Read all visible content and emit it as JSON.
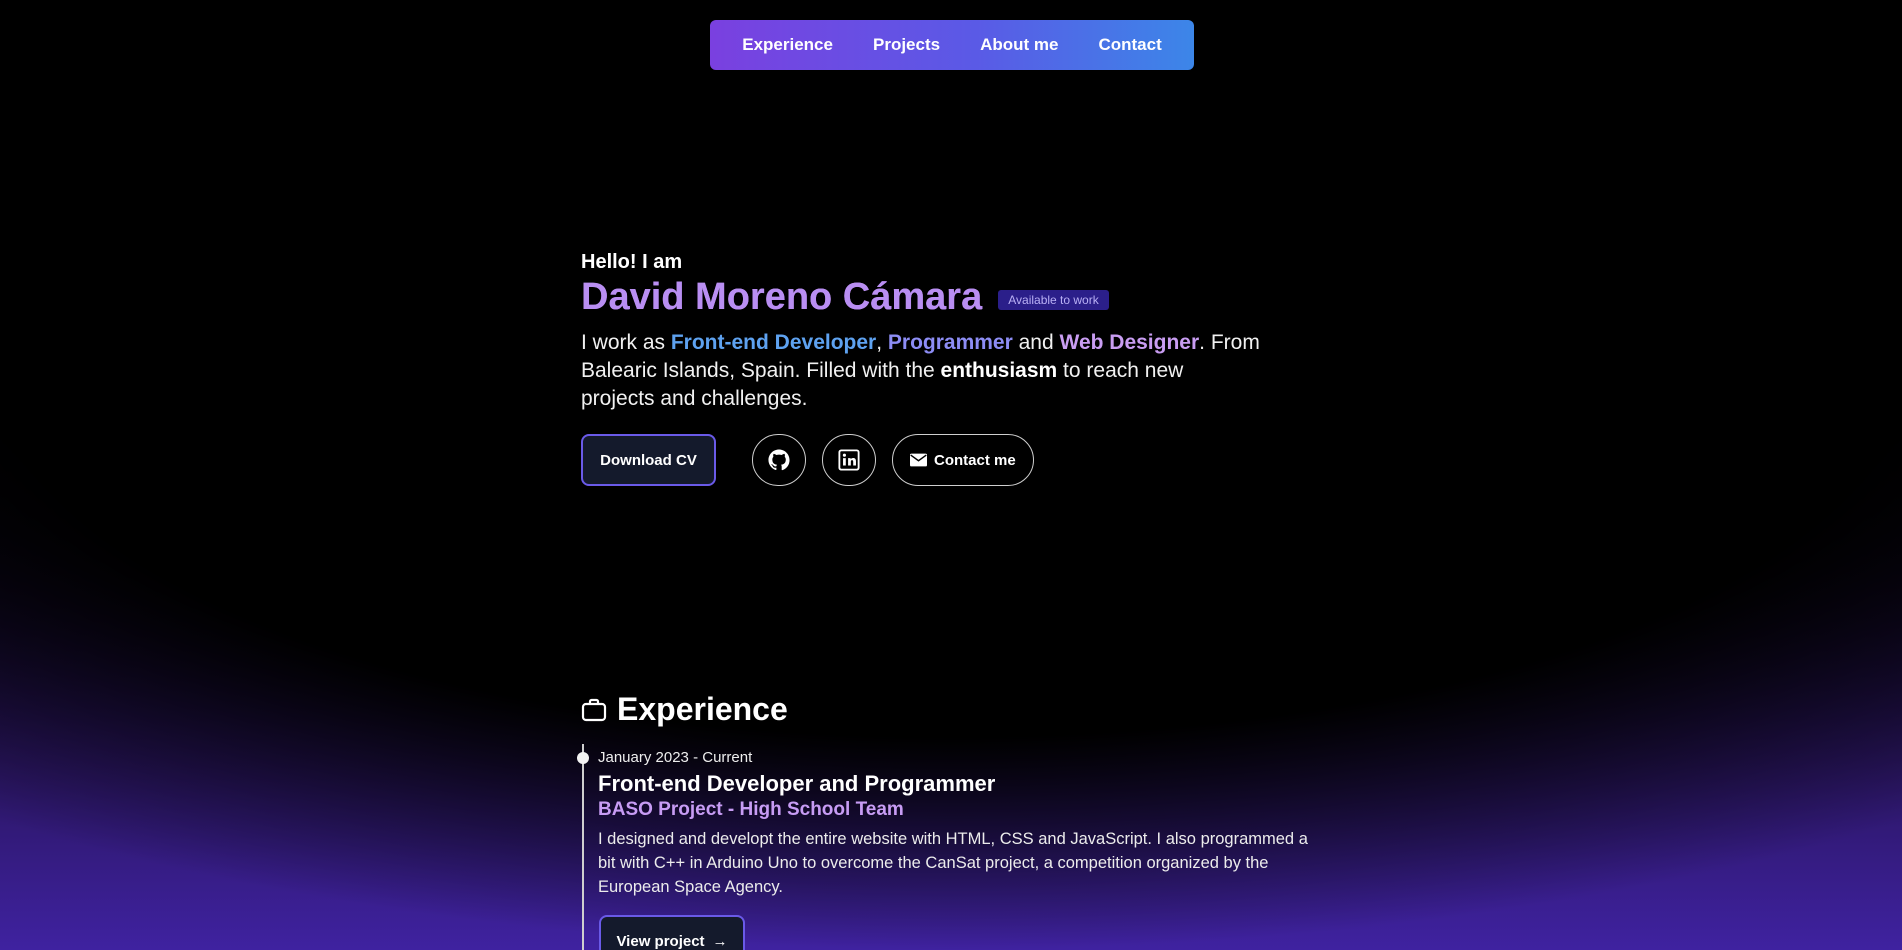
{
  "nav": {
    "items": [
      {
        "label": "Experience"
      },
      {
        "label": "Projects"
      },
      {
        "label": "About me"
      },
      {
        "label": "Contact"
      }
    ]
  },
  "hero": {
    "greeting": "Hello! I am",
    "name": "David Moreno Cámara",
    "badge": "Available to work",
    "intro": {
      "p1": "I work as ",
      "role1": "Front-end Developer",
      "p2": ", ",
      "role2": "Programmer",
      "p3": " and ",
      "role3": "Web Designer",
      "p4": ". From Balearic Islands, Spain. Filled with the ",
      "highlight": "enthusiasm",
      "p5": " to reach new projects and challenges."
    },
    "download_cv_label": "Download CV",
    "contact_label": "Contact me",
    "icons": [
      "github-icon",
      "linkedin-icon",
      "mail-icon"
    ]
  },
  "experience": {
    "title": "Experience",
    "icon": "briefcase-icon",
    "items": [
      {
        "date": "January 2023 - Current",
        "role": "Front-end Developer and Programmer",
        "company": "BASO Project - High School Team",
        "description": "I designed and developt the entire website with HTML, CSS and JavaScript. I also programmed a bit with C++ in Arduino Uno to overcome the CanSat project, a competition organized by the European Space Agency.",
        "button_label": "View project",
        "button_arrow": "→"
      }
    ]
  },
  "colors": {
    "accent_purple": "#b98ef2",
    "accent_blue": "#5ea2f0",
    "nav_gradient_start": "#7a40e0",
    "nav_gradient_end": "#3c86e8",
    "badge_bg": "#2b1f8a"
  }
}
